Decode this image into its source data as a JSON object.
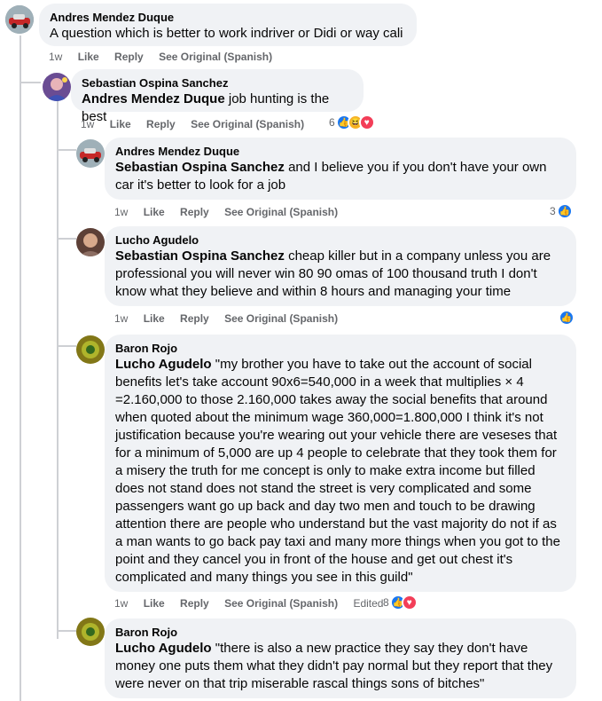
{
  "comments": [
    {
      "author": "Andres Mendez Duque",
      "text": "A question which is better to work indriver or Didi or way cali",
      "time": "1w",
      "like": "Like",
      "reply": "Reply",
      "see_original": "See Original (Spanish)"
    },
    {
      "author": "Sebastian Ospina Sanchez",
      "mention": "Andres Mendez Duque",
      "text": "job hunting is the best",
      "time": "1w",
      "like": "Like",
      "reply": "Reply",
      "see_original": "See Original (Spanish)",
      "reaction_count": "6",
      "reaction_icons": [
        "like-icon",
        "haha-icon",
        "love-icon"
      ]
    },
    {
      "author": "Andres Mendez Duque",
      "mention": "Sebastian Ospina Sanchez",
      "text": "and I believe you if you don't have your own car it's better to look for a job",
      "time": "1w",
      "like": "Like",
      "reply": "Reply",
      "see_original": "See Original (Spanish)",
      "reaction_count": "3",
      "reaction_icons": [
        "like-icon"
      ]
    },
    {
      "author": "Lucho Agudelo",
      "mention": "Sebastian Ospina Sanchez",
      "text": "cheap killer but in a company unless you are professional you will never win 80 90 omas of 100 thousand truth I don't know what they believe and within 8 hours and managing your time",
      "time": "1w",
      "like": "Like",
      "reply": "Reply",
      "see_original": "See Original (Spanish)",
      "reaction_icons": [
        "like-icon"
      ]
    },
    {
      "author": "Baron Rojo",
      "mention": "Lucho Agudelo",
      "text": "\"my brother you have to take out the account of social benefits let's take account 90x6=540,000 in a week that multiplies × 4 =2.160,000 to those 2.160,000 takes away the social benefits that around when quoted about the minimum wage 360,000=1.800,000 I think it's not justification because you're wearing out your vehicle there are veseses that for a minimum of 5,000 are up 4 people to celebrate that they took them for a misery the truth for me concept is only to make extra income but filled does not stand does not stand the street is very complicated and some passengers want go up back and day two men and touch to be drawing attention there are people who understand but the vast majority do not if as a man wants to go back pay taxi and many more things when you got to the point and they cancel you in front of the house and get out chest it's complicated and many things you see in this guild\"",
      "time": "1w",
      "like": "Like",
      "reply": "Reply",
      "see_original": "See Original (Spanish)",
      "edited": "Edited",
      "reaction_count": "8",
      "reaction_icons": [
        "like-icon",
        "love-icon"
      ]
    },
    {
      "author": "Baron Rojo",
      "mention": "Lucho Agudelo",
      "text": "\"there is also a new practice they say they don't have money one puts them what they didn't pay normal but they report that they were never on that trip miserable rascal things sons of bitches\""
    }
  ],
  "colors": {
    "bubble": "#f0f2f5",
    "like": "#1877f2",
    "love": "#f33e58",
    "haha": "#f7b125",
    "meta": "#65676b"
  }
}
